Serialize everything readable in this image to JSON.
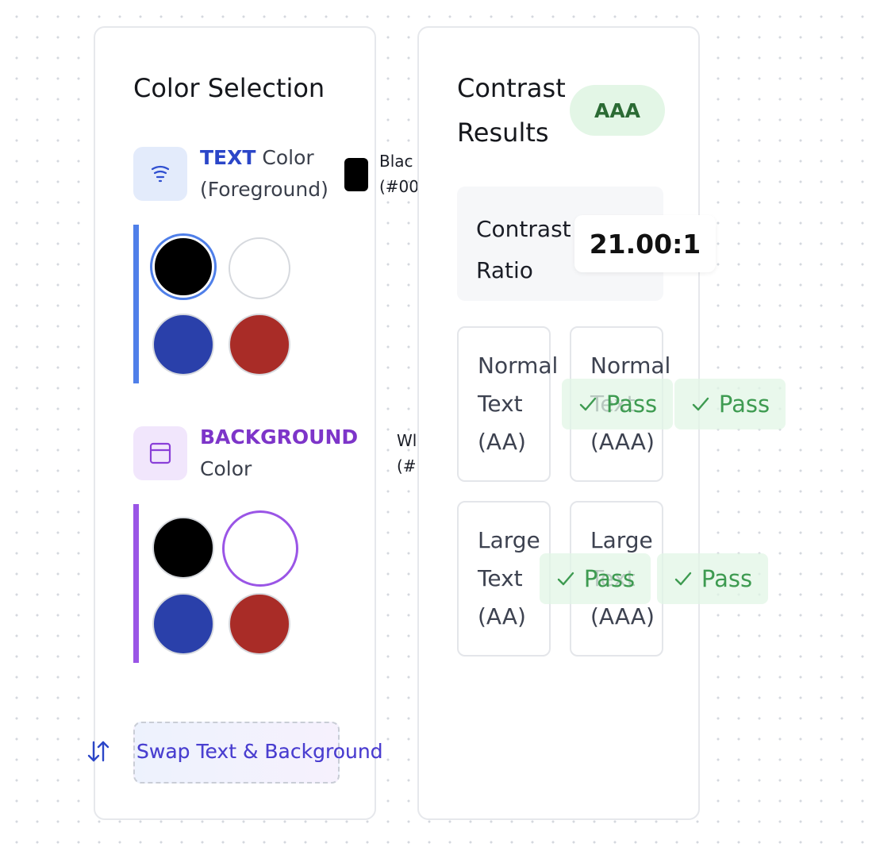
{
  "colors": {
    "accent_blue": "#4f7fe9",
    "accent_purple": "#9a55e6",
    "black": "#000000",
    "white": "#ffffff",
    "blue": "#2a40aa",
    "red": "#a92c27",
    "pass_green": "#3e9b51"
  },
  "selection": {
    "title": "Color Selection",
    "text_section": {
      "keyword": "TEXT",
      "rest": " Color (Foreground)",
      "current": "Blac\n(#00",
      "icon": "filter-lines-icon"
    },
    "background_section": {
      "keyword": "BACKGROUND",
      "rest": "Color",
      "current": "Wl\n(#",
      "icon": "window-layout-icon"
    },
    "swap_label": "Swap Text & Background",
    "swap_icon": "swap-vertical-icon"
  },
  "results": {
    "title": "Contrast Results",
    "badge": "AAA",
    "ratio_label": "Contrast Ratio",
    "ratio_value": "21.00:1",
    "tiles": [
      {
        "label": "Normal Text (AA)",
        "status": "Pass"
      },
      {
        "label": "Normal Text (AAA)",
        "status": "Pass"
      },
      {
        "label": "Large Text (AA)",
        "status": "Pass"
      },
      {
        "label": "Large Text (AAA)",
        "status": "Pass"
      }
    ]
  }
}
